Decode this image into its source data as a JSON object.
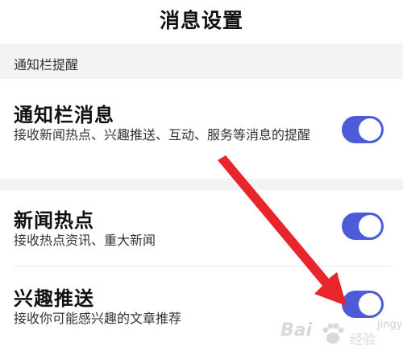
{
  "header": {
    "title": "消息设置"
  },
  "section": {
    "label": "通知栏提醒"
  },
  "settings": [
    {
      "title": "通知栏消息",
      "desc": "接收新闻热点、兴趣推送、互动、服务等消息的提醒",
      "enabled": true
    },
    {
      "title": "新闻热点",
      "desc": "接收热点资讯、重大新闻",
      "enabled": true
    },
    {
      "title": "兴趣推送",
      "desc": "接收你可能感兴趣的文章推荐",
      "enabled": true
    }
  ],
  "colors": {
    "toggle_on": "#4d5bd8",
    "arrow": "#e8252a",
    "section_bg": "#f3f3f3"
  },
  "watermark": {
    "brand": "Bai",
    "suffix": "经验",
    "domain": "jingyan"
  }
}
